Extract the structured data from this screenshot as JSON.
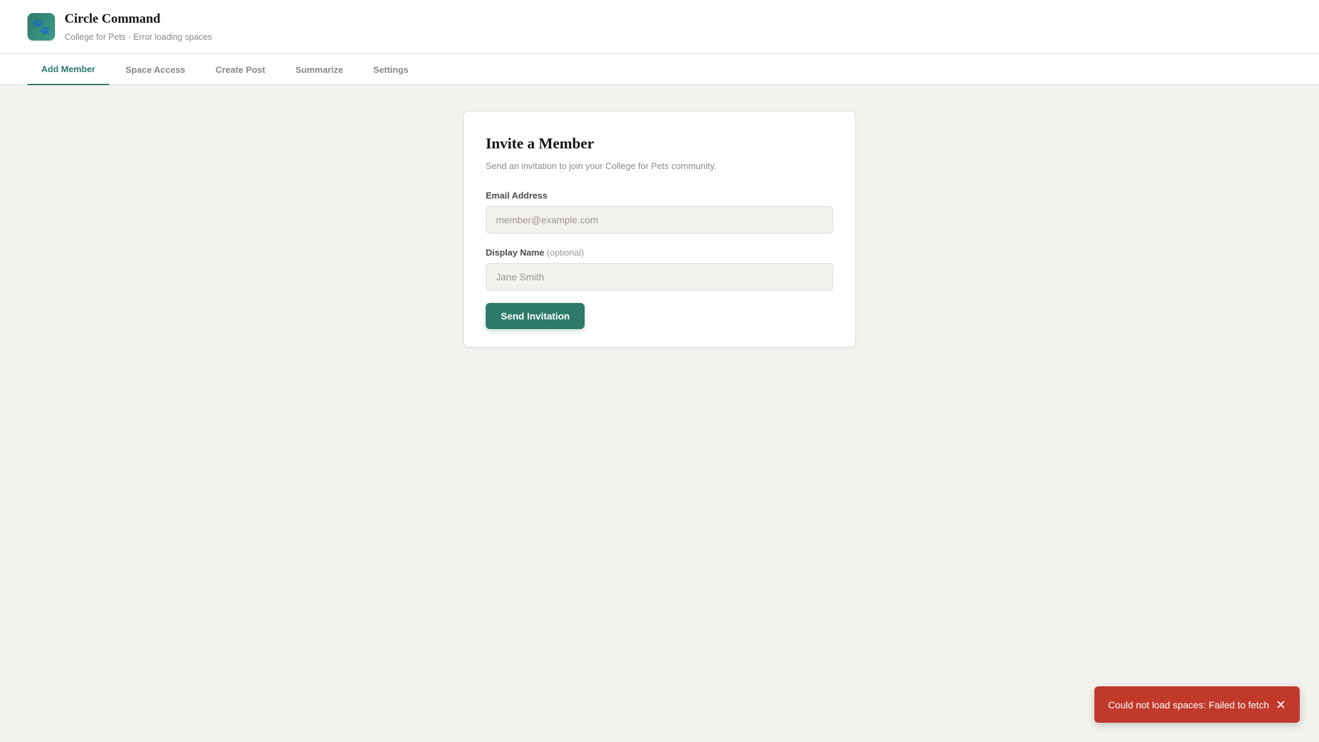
{
  "app": {
    "title": "Circle Command",
    "subtitle": "College for Pets · Error loading spaces",
    "logo_icon": "🐾"
  },
  "tabs": [
    {
      "label": "Add Member",
      "active": true
    },
    {
      "label": "Space Access",
      "active": false
    },
    {
      "label": "Create Post",
      "active": false
    },
    {
      "label": "Summarize",
      "active": false
    },
    {
      "label": "Settings",
      "active": false
    }
  ],
  "invite": {
    "title": "Invite a Member",
    "description": "Send an invitation to join your College for Pets community.",
    "email_label": "Email Address",
    "email_value": "",
    "email_placeholder": "member@example.com",
    "name_label": "Display Name",
    "name_optional": "(optional)",
    "name_value": "",
    "name_placeholder": "Jane Smith",
    "submit_label": "Send Invitation"
  },
  "toast": {
    "message": "Could not load spaces: Failed to fetch",
    "close_icon": "✕"
  },
  "colors": {
    "accent": "#2e7a6a",
    "background": "#f3f2ef",
    "error": "#c0392b"
  }
}
